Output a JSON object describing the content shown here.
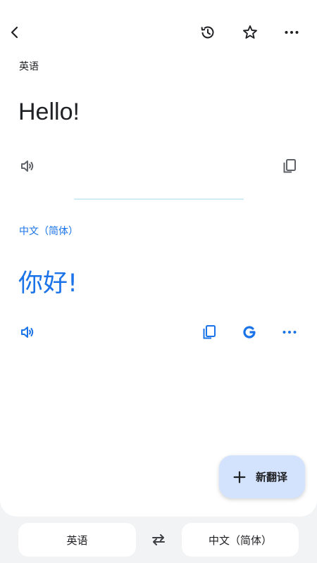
{
  "header": {
    "back_icon": "arrow-back-icon",
    "history_icon": "history-icon",
    "star_icon": "star-outline-icon",
    "more_icon": "more-horizontal-icon"
  },
  "source": {
    "language": "英语",
    "text": "Hello!",
    "speak_icon": "volume-icon",
    "copy_icon": "copy-icon"
  },
  "target": {
    "language": "中文（简体）",
    "text": "你好!",
    "speak_icon": "volume-icon",
    "copy_icon": "copy-icon",
    "google_icon": "google-g-icon",
    "more_icon": "more-horizontal-icon"
  },
  "fab": {
    "label": "新翻译",
    "icon": "plus-icon"
  },
  "bottom_bar": {
    "source_language": "英语",
    "swap_icon": "swap-arrows-icon",
    "target_language": "中文（简体）"
  },
  "colors": {
    "accent": "#1a73e8",
    "fab_bg": "#d3e3fd",
    "divider": "#d2ecf7",
    "background": "#f1f3f4"
  }
}
